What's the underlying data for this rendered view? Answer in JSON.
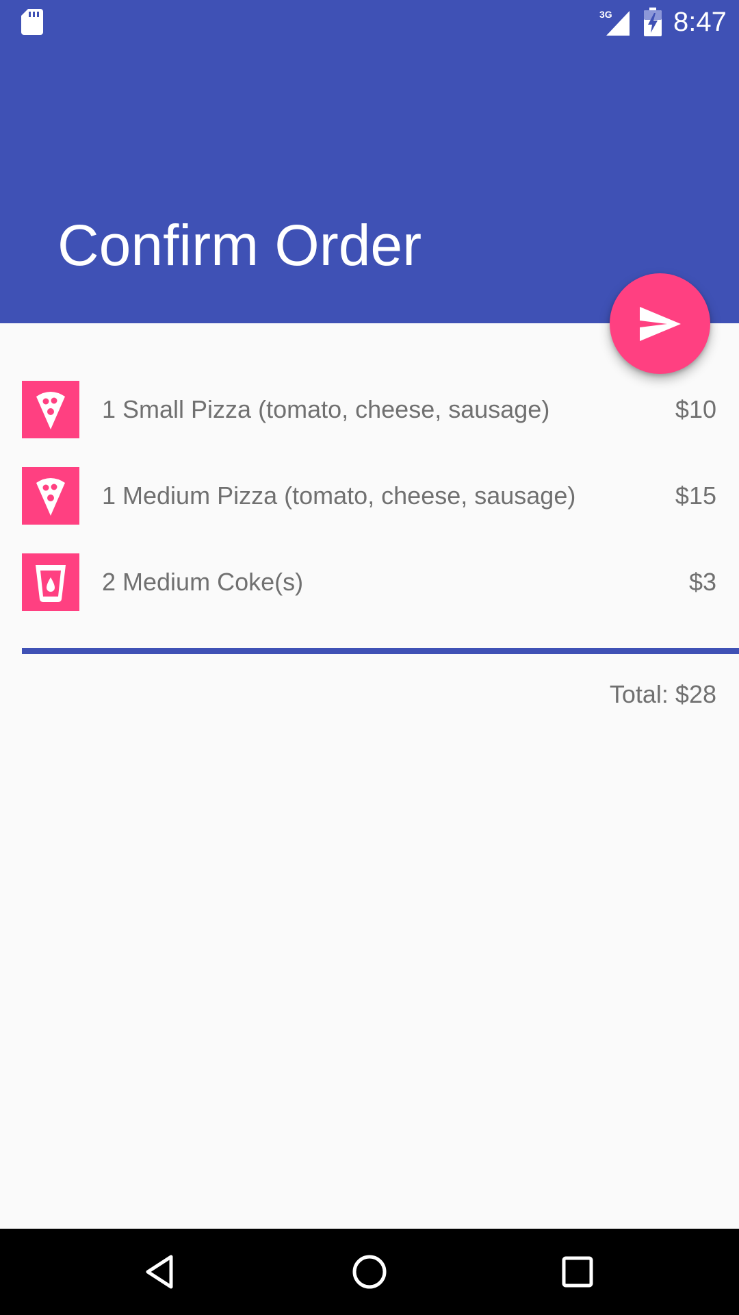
{
  "status_bar": {
    "time": "8:47",
    "network_label": "3G",
    "icons": [
      "sd-card-icon",
      "cellular-signal-icon",
      "battery-charging-icon"
    ]
  },
  "app_bar": {
    "title": "Confirm Order",
    "color": "#3f51b5"
  },
  "fab": {
    "icon": "send-icon",
    "color": "#ff4081"
  },
  "order": {
    "items": [
      {
        "icon": "pizza-icon",
        "description": "1 Small Pizza (tomato, cheese, sausage)",
        "price": "$10"
      },
      {
        "icon": "pizza-icon",
        "description": "1 Medium Pizza (tomato, cheese, sausage)",
        "price": "$15"
      },
      {
        "icon": "drink-icon",
        "description": "2 Medium Coke(s)",
        "price": "$3"
      }
    ],
    "total": "Total: $28"
  },
  "nav_bar": {
    "buttons": [
      "back-icon",
      "home-icon",
      "recents-icon"
    ]
  }
}
